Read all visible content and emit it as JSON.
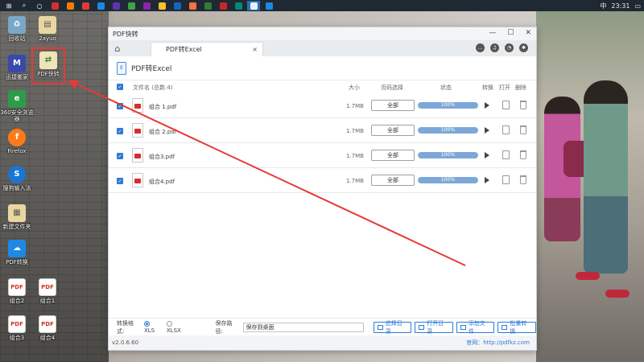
{
  "taskbar": {
    "items": [
      "⊞",
      "⌕",
      "○",
      "▶",
      "◆",
      "●",
      "◎",
      "▤",
      "▦",
      "▣",
      "◉",
      "◈",
      "◆",
      "X",
      "◎",
      "◆",
      "◧",
      "▦"
    ],
    "tray": {
      "lang": "中",
      "time": "23:31"
    }
  },
  "desktop_icons": [
    {
      "label": "回收站"
    },
    {
      "label": "2ayuo"
    },
    {
      "label": "迅捷搬家"
    },
    {
      "label": "PDF快转"
    },
    {
      "label": "360安全浏览器"
    },
    {
      "label": "Firefox"
    },
    {
      "label": "搜狗输入法"
    },
    {
      "label": "新建文件夹"
    },
    {
      "label": "PDF转换"
    },
    {
      "label": "组合2"
    },
    {
      "label": "组合1"
    },
    {
      "label": "组合3"
    },
    {
      "label": "组合4"
    }
  ],
  "window": {
    "title": "PDF快转",
    "tab_label": "PDF转Excel",
    "tab_close": "×",
    "section_title": "PDF转Excel",
    "section_icon_text": "E",
    "controls": {
      "minimize": "—",
      "maximize": "☐",
      "close": "✕"
    }
  },
  "table": {
    "headers": {
      "filename": "文件名 (总数:4)",
      "size": "大小",
      "page_select": "页码选择",
      "status": "状态",
      "convert": "转换",
      "open": "打开",
      "delete": "删除"
    },
    "rows": [
      {
        "name": "组合 1.pdf",
        "size": "1.7MB",
        "range": "全部",
        "progress": "100%"
      },
      {
        "name": "组合 2.pdf",
        "size": "1.7MB",
        "range": "全部",
        "progress": "100%"
      },
      {
        "name": "组合3.pdf",
        "size": "1.7MB",
        "range": "全部",
        "progress": "100%"
      },
      {
        "name": "组合4.pdf",
        "size": "1.7MB",
        "range": "全部",
        "progress": "100%"
      }
    ]
  },
  "footer": {
    "format_label": "转换格式:",
    "format_xls": "XLS",
    "format_xlsx": "XLSX",
    "save_label": "保存路径:",
    "save_value": "保存到桌面",
    "btn_select_dir": "选择目录",
    "btn_open_dir": "打开目录",
    "btn_add_file": "添加文件",
    "btn_batch_convert": "批量转换"
  },
  "status": {
    "version": "v2.0.6.60",
    "site": "官网：http://pdfkz.com"
  },
  "colors": {
    "accent": "#2f7bd6",
    "progress": "#7da7d9",
    "highlight": "#e53935"
  }
}
